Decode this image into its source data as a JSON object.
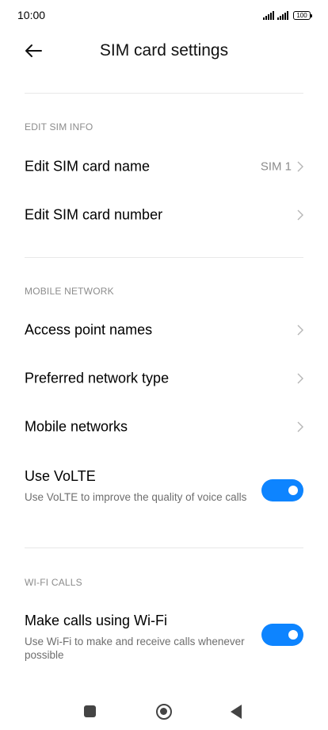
{
  "status_bar": {
    "time": "10:00",
    "battery": "100"
  },
  "header": {
    "back_icon": "arrow-left-icon",
    "title": "SIM card settings"
  },
  "sections": {
    "edit_sim_info": {
      "title": "EDIT SIM INFO",
      "items": [
        {
          "label": "Edit SIM card name",
          "value": "SIM 1"
        },
        {
          "label": "Edit SIM card number",
          "value": ""
        }
      ]
    },
    "mobile_network": {
      "title": "MOBILE NETWORK",
      "items": [
        {
          "label": "Access point names"
        },
        {
          "label": "Preferred network type"
        },
        {
          "label": "Mobile networks"
        }
      ],
      "volte": {
        "title": "Use VoLTE",
        "description": "Use VoLTE to improve the quality of voice calls",
        "enabled": true
      }
    },
    "wifi_calls": {
      "title": "WI-FI CALLS",
      "wifi_calling": {
        "title": "Make calls using Wi-Fi",
        "description": "Use Wi-Fi to make and receive calls whenever possible",
        "enabled": true
      }
    }
  },
  "nav_bar": {
    "recents_icon": "square-icon",
    "home_icon": "circle-icon",
    "back_icon": "triangle-back-icon"
  },
  "colors": {
    "accent": "#0d84ff",
    "secondary_text": "#8c8c8c",
    "divider": "#e8e8e8"
  }
}
